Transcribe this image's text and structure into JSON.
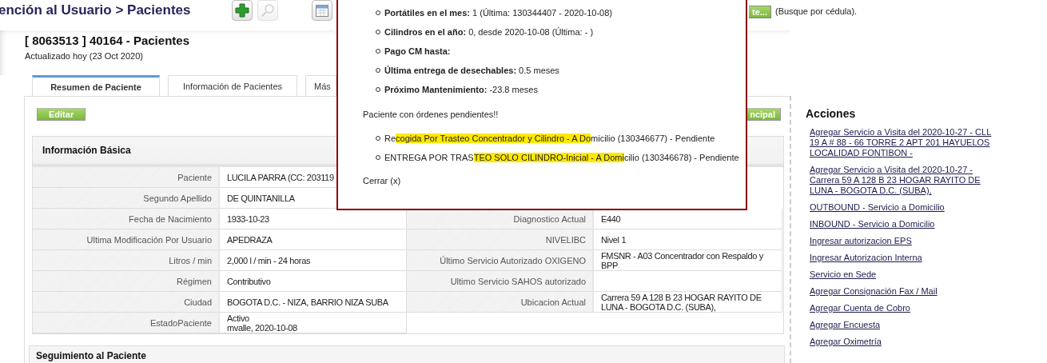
{
  "header": {
    "breadcrumb": "ención al Usuario > Pacientes",
    "search_button": "te...",
    "search_hint": "(Busque por cédula)."
  },
  "record": {
    "title": "[ 8063513 ] 40164 - Pacientes",
    "updated": "Actualizado hoy (23 Oct 2020)"
  },
  "tabs": [
    {
      "label": "Resumen de Paciente",
      "selected": true
    },
    {
      "label": "Información de Pacientes",
      "selected": false
    },
    {
      "label": "Más",
      "selected": false
    }
  ],
  "edit_button": "Editar",
  "principal_button": "ncipal",
  "basic_info": {
    "title": "Información Básica",
    "rows": [
      {
        "left": {
          "label": "Paciente",
          "value": "LUCILA PARRA (CC: 203119"
        }
      },
      {
        "left": {
          "label": "Segundo Apellido",
          "value": "DE QUINTANILLA"
        }
      },
      {
        "left": {
          "label": "Fecha de Nacimiento",
          "value": "1933-10-23"
        },
        "right": {
          "label": "Diagnostico Actual",
          "value": "E440"
        }
      },
      {
        "left": {
          "label": "Ultima Modificación Por Usuario",
          "value": "APEDRAZA"
        },
        "right": {
          "label": "NIVELIBC",
          "value": "Nivel 1"
        }
      },
      {
        "left": {
          "label": "Litros / min",
          "value": "2,000 l / min - 24 horas"
        },
        "right": {
          "label": "Último Servicio Autorizado OXIGENO",
          "value": "FMSNR - A03 Concentrador con Respaldo y BPP"
        }
      },
      {
        "left": {
          "label": "Régimen",
          "value": "Contributivo"
        },
        "right": {
          "label": "Ultimo Servicio SAHOS autorizado"
        }
      },
      {
        "left": {
          "label": "Ciudad",
          "value": "BOGOTA D.C. - NIZA, BARRIO NIZA SUBA"
        },
        "right": {
          "label": "Ubicacion Actual",
          "value": "Carrera 59 A 128 B 23 HOGAR RAYITO DE LUNA - BOGOTA D.C. (SUBA),"
        }
      },
      {
        "left": {
          "label": "EstadoPaciente",
          "value": "Activo\nmvalle, 2020-10-08"
        }
      }
    ]
  },
  "follow_up": {
    "title": "Seguimiento al Paciente"
  },
  "actions": {
    "title": "Acciones",
    "links": [
      "Agregar Servicio a Visita del 2020-10-27 - CLL 19 A # 88 - 66 TORRE 2 APT 201 HAYUELOS LOCALIDAD FONTIBON -",
      "Agregar Servicio a Visita del 2020-10-27 - Carrera 59 A 128 B 23 HOGAR RAYITO DE LUNA - BOGOTA D.C. (SUBA),",
      "OUTBOUND - Servicio a Domicilio",
      "INBOUND - Servicio a Domicilio",
      "Ingresar autorizacion EPS",
      "Ingresar Autorizacion Interna",
      "Servicio en Sede",
      "Agregar Consignación Fax / Mail",
      "Agregar Cuenta de Cobro",
      "Agregar Encuesta",
      "Agregar Oximetría"
    ]
  },
  "popup": {
    "facts": [
      {
        "label": "Portátiles en el mes:",
        "value": "1 (Última: 130344407 - 2020-10-08)"
      },
      {
        "label": "Cilindros en el año:",
        "value": "0, desde 2020-10-08 (Última: - )"
      },
      {
        "label": "Pago CM hasta:"
      },
      {
        "label": "Última entrega de desechables:",
        "value": "0.5 meses"
      },
      {
        "label": "Próximo Mantenimiento:",
        "value": "-23.8 meses"
      }
    ],
    "notice": "Paciente con órdenes pendientes!!",
    "orders": [
      {
        "before": "Re",
        "highlighted": "cogida Por Trasteo Concentrador y Cilindro - A Do",
        "after": "micilio (130346677) - Pendiente"
      },
      {
        "before": "ENTREGA POR TRAS",
        "highlighted": "TEO SOLO CILINDRO-Inicial - A Domi",
        "after": "cilio (130346678) - Pendiente"
      }
    ],
    "close": "Cerrar (x)"
  }
}
